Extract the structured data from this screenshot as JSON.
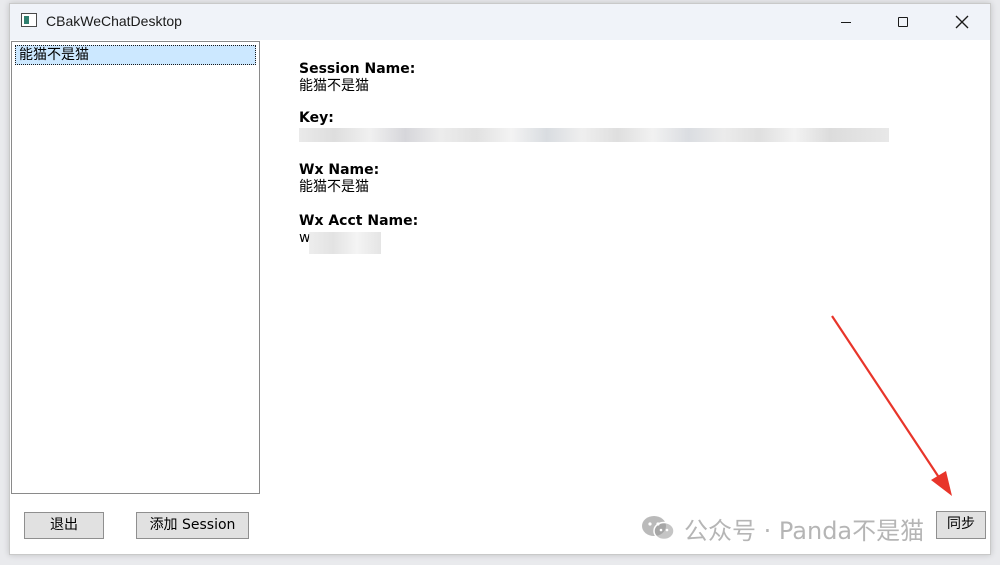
{
  "window": {
    "title": "CBakWeChatDesktop",
    "icon": "app-window-icon"
  },
  "session_list": {
    "items": [
      {
        "label": "能猫不是猫",
        "selected": true
      }
    ]
  },
  "details": {
    "session_name_label": "Session Name:",
    "session_name_value": "能猫不是猫",
    "key_label": "Key:",
    "key_value_prefix": "",
    "wx_name_label": "Wx Name:",
    "wx_name_value": "能猫不是猫",
    "wx_acct_name_label": "Wx Acct Name:",
    "wx_acct_name_prefix": "w"
  },
  "buttons": {
    "exit_label": "退出",
    "add_session_label": "添加 Session",
    "sync_label": "同步"
  },
  "watermark": {
    "text": "公众号 · Panda不是猫"
  },
  "colors": {
    "selection_bg": "#cce8ff",
    "button_bg": "#e1e1e1",
    "arrow": "#e8352a",
    "titlebar_bg": "#f0f3f9"
  }
}
